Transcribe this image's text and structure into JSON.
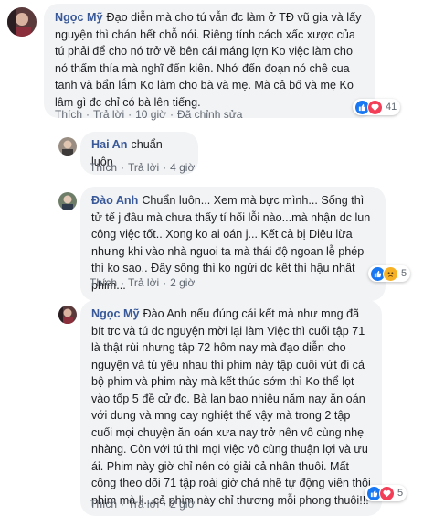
{
  "comments": [
    {
      "author": "Ngọc Mỹ",
      "text": "Đạo diễn mà cho tú vẫn đc làm ở TĐ vũ gia và lấy nguyện thì chán hết chỗ nói. Riêng tính cách xấc xược của tú phải để cho nó trở về bên cái máng lợn Ko việc làm cho nó thấm thía mà nghĩ đến kiên. Nhớ đến đoạn nó chê cua tanh và bẩn lắm Ko làm cho bà và mẹ. Mà cả bố và mẹ Ko lâm gì đc chỉ có bà lên tiếng.",
      "like": "Thích",
      "reply": "Trả lời",
      "time": "10 giờ",
      "edited": "Đã chỉnh sửa",
      "reaction_count": "41",
      "reactions": [
        "like-icon",
        "love-icon"
      ]
    },
    {
      "author": "Hai An",
      "text": "chuẩn luôn",
      "like": "Thích",
      "reply": "Trả lời",
      "time": "4 giờ"
    },
    {
      "author": "Đào Anh",
      "text": "Chuẩn luôn... Xem mà bực mình... Sống thì tử tế j đâu mà chưa thấy tí hối lỗi nào...mà nhận dc lun công việc tốt.. Xong ko ai oán j... Kết cả bị Diệu lừa nhưng khi vào nhà nguoi ta mà thái độ ngoan lễ phép thì ko sao.. Đây sông thì ko ngửi dc kết thì hậu nhất phim...",
      "like": "Thích",
      "reply": "Trả lời",
      "time": "2 giờ",
      "reaction_count": "5",
      "reactions": [
        "like-icon",
        "sad-icon"
      ]
    },
    {
      "author": "Ngọc Mỹ",
      "text": "Đào Anh nếu đúng cái kết mà như mng đã bít trc và tú dc nguyện mời lại làm Việc thì cuối tập 71 là thật rùi nhưng tập 72 hôm nay mà đạo diễn cho nguyện và tú yêu nhau thì phim này tập cuối vứt đi cả bộ phim và phim này mà kết thúc sớm thì Ko thể lọt vào tốp 5 đề cử đc. Bà lan bao nhiêu năm nay ăn oán với dung và mng cay nghiệt thế vậy mà trong 2 tập cuối mọi chuyện ăn oán xưa nay trở nên vô cùng nhẹ nhàng. Còn với tú thì mọi việc vô cùng thuận lợi và ưu ái. Phim này giờ chỉ nên có giải cả nhân thuôi. Mất công theo dõi 71 tập roài giờ chả nhẽ tự động viên thôi phim mà lị...cả phim này chỉ thương mỗi phong thuôi!!!",
      "like": "Thích",
      "reply": "Trả lời",
      "time": "2 giờ",
      "reaction_count": "5",
      "reactions": [
        "like-icon",
        "love-icon"
      ]
    }
  ],
  "colors": {
    "author": "#385898",
    "bubble": "#f2f3f5",
    "meta": "#606770",
    "like": "#1877f2",
    "love": "#f33e58",
    "sad": "#f7b125"
  }
}
